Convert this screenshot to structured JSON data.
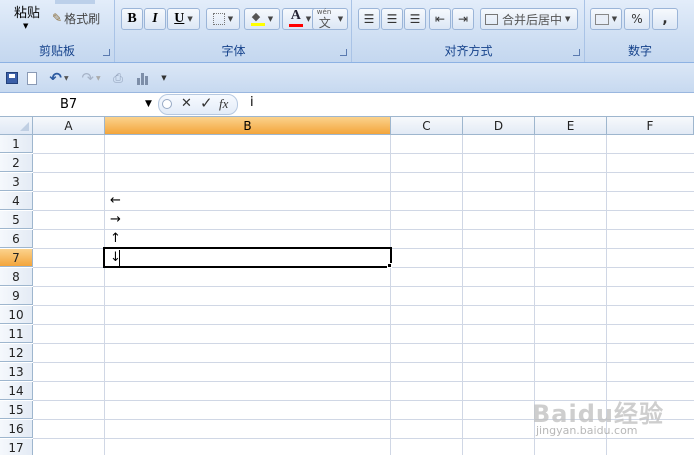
{
  "ribbon": {
    "clipboard": {
      "paste_label": "粘贴",
      "format_painter_label": "格式刷",
      "group_label": "剪贴板"
    },
    "font": {
      "bold_label": "B",
      "italic_label": "I",
      "underline_label": "U",
      "font_color_label": "A",
      "phonetic_label": "wén",
      "phonetic_char": "文",
      "group_label": "字体",
      "font_color": "#ff0000",
      "fill_color": "#ffff00"
    },
    "alignment": {
      "merge_center_label": "合并后居中",
      "group_label": "对齐方式"
    },
    "number": {
      "percent_label": "%",
      "comma_label": ",",
      "group_label": "数字"
    }
  },
  "formula_bar": {
    "name_box_value": "B7",
    "cancel_symbol": "✕",
    "enter_symbol": "✓",
    "fx_label": "fx",
    "input_value": "i"
  },
  "grid": {
    "columns": [
      "A",
      "B",
      "C",
      "D",
      "E",
      "F"
    ],
    "active_column": "B",
    "rows": [
      "1",
      "2",
      "3",
      "4",
      "5",
      "6",
      "7",
      "8",
      "9",
      "10",
      "11",
      "12",
      "13",
      "14",
      "15",
      "16",
      "17"
    ],
    "active_row": "7",
    "cells": {
      "B4": "←",
      "B5": "→",
      "B6": "↑",
      "B7": "↓"
    },
    "selected_cell": "B7"
  },
  "watermark": {
    "brand": "Baidu经验",
    "url": "jingyan.baidu.com"
  },
  "colors": {
    "ribbon_label": "#15428b",
    "active_header": "#f3a53c",
    "gridline": "#d0d7e5"
  }
}
